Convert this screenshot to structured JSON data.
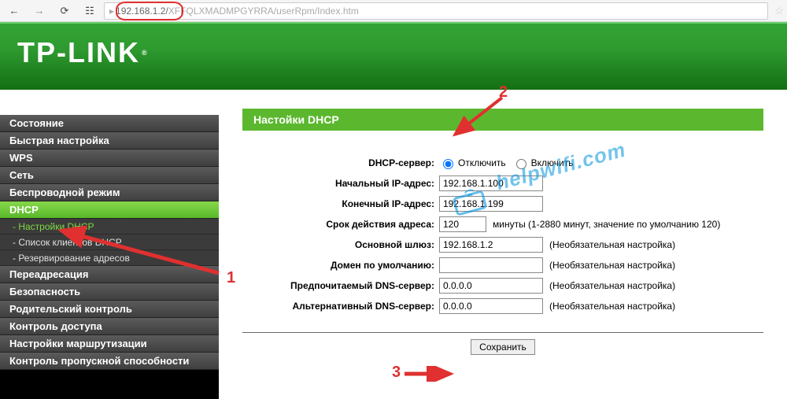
{
  "browser": {
    "url_ip": "192.168.1.2/",
    "url_rest": "XFFQLXMADMPGYRRA/userRpm/Index.htm"
  },
  "logo": "TP-LINK",
  "sidebar": {
    "items": [
      "Состояние",
      "Быстрая настройка",
      "WPS",
      "Сеть",
      "Беспроводной режим",
      "DHCP",
      "Переадресация",
      "Безопасность",
      "Родительский контроль",
      "Контроль доступа",
      "Настройки маршрутизации",
      "Контроль пропускной способности"
    ],
    "subs": [
      "- Настройки DHCP",
      "- Список клиентов DHCP",
      "- Резервирование адресов"
    ]
  },
  "panel": {
    "title": "Настойки DHCP",
    "dhcp_label": "DHCP-сервер:",
    "opt_off": "Отключить",
    "opt_on": "Включить",
    "start_label": "Начальный IP-адрес:",
    "start_val": "192.168.1.100",
    "end_label": "Конечный IP-адрес:",
    "end_val": "192.168.1.199",
    "lease_label": "Срок действия адреса:",
    "lease_val": "120",
    "lease_hint": "минуты (1-2880 минут, значение по умолчанию 120)",
    "gw_label": "Основной шлюз:",
    "gw_val": "192.168.1.2",
    "optional": "(Необязательная настройка)",
    "domain_label": "Домен по умолчанию:",
    "domain_val": "",
    "dns1_label": "Предпочитаемый DNS-сервер:",
    "dns1_val": "0.0.0.0",
    "dns2_label": "Альтернативный DNS-сервер:",
    "dns2_val": "0.0.0.0",
    "save": "Сохранить"
  },
  "anno": {
    "n1": "1",
    "n2": "2",
    "n3": "3"
  },
  "watermark": "helpwifi.com"
}
